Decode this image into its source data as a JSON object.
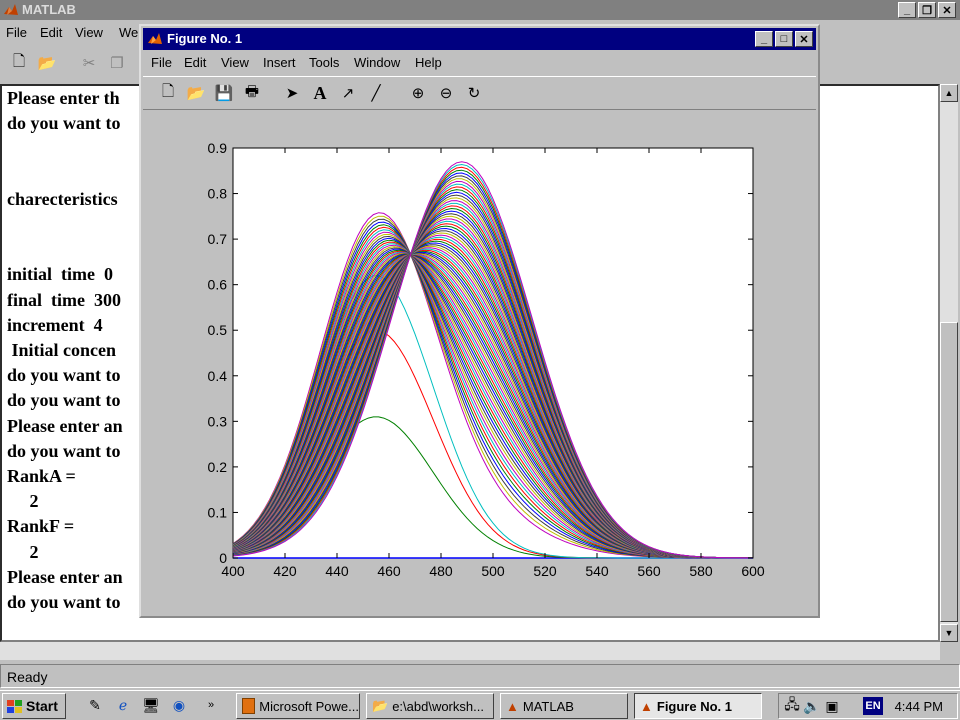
{
  "matlab": {
    "title": "MATLAB",
    "menu": [
      "File",
      "Edit",
      "View",
      "We"
    ],
    "status": "Ready",
    "command_lines": [
      "Please enter th",
      "do you want to",
      "",
      "",
      "charecteristics",
      "",
      "",
      "initial  time  0",
      "final  time  300",
      "increment  4",
      " Initial concen",
      "do you want to",
      "do you want to",
      "Please enter an",
      "do you want to",
      "RankA =",
      "     2",
      "RankF =",
      "     2",
      "Please enter an",
      "do you want to"
    ]
  },
  "figure": {
    "title": "Figure No. 1",
    "menu": [
      "File",
      "Edit",
      "View",
      "Insert",
      "Tools",
      "Window",
      "Help"
    ]
  },
  "chart_data": {
    "type": "line",
    "title": "",
    "xlabel": "",
    "ylabel": "",
    "xlim": [
      400,
      600
    ],
    "ylim": [
      0,
      0.9
    ],
    "x_ticks": [
      400,
      420,
      440,
      460,
      480,
      500,
      520,
      540,
      560,
      580,
      600
    ],
    "y_ticks": [
      0,
      0.1,
      0.2,
      0.3,
      0.4,
      0.5,
      0.6,
      0.7,
      0.8,
      0.9
    ],
    "grid": false,
    "component_a": {
      "peak_x": 455,
      "width": 22,
      "max_y": 0.8
    },
    "component_b": {
      "peak_x": 488,
      "width": 27,
      "max_y": 0.87
    },
    "series_count": 75,
    "visible_series": [
      {
        "name": "",
        "color": "#0000ff",
        "peak_y": 0.0
      },
      {
        "name": "",
        "color": "#008000",
        "peak_y": 0.31
      },
      {
        "name": "",
        "color": "#ff0000",
        "peak_y": 0.5
      },
      {
        "name": "",
        "color": "#00bfbf",
        "peak_y": 0.62
      },
      {
        "name": "",
        "color": "#bf00bf",
        "peak_y": 0.7
      }
    ],
    "color_cycle": [
      "#0000ff",
      "#008000",
      "#ff0000",
      "#00bfbf",
      "#bf00bf",
      "#bfbf00",
      "#404040"
    ]
  },
  "taskbar": {
    "start_label": "Start",
    "tasks": [
      "Microsoft Powe...",
      "e:\\abd\\worksh...",
      "MATLAB",
      "Figure No. 1"
    ],
    "active_task": "Figure No. 1",
    "language": "EN",
    "clock": "4:44 PM"
  }
}
